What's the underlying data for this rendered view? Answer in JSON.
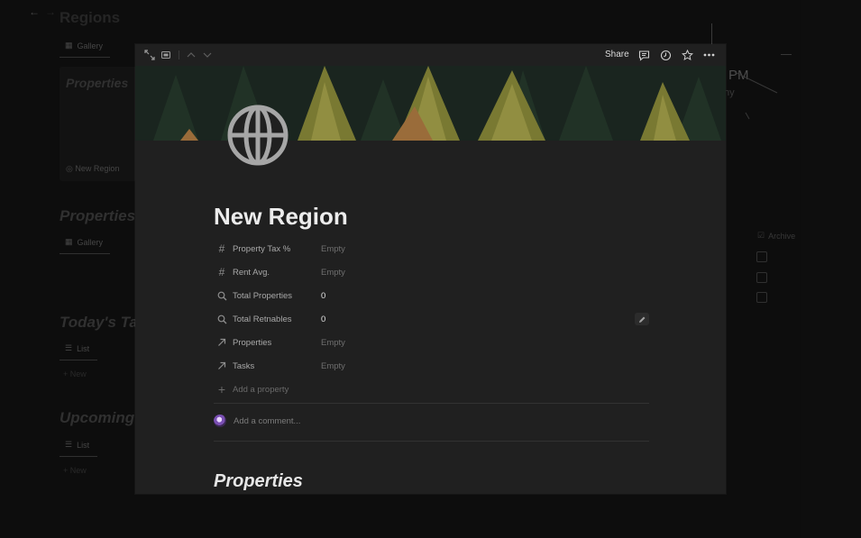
{
  "background": {
    "nav_back": "←",
    "nav_fwd": "→",
    "page_title": "Regions",
    "section1_tab": "Gallery",
    "card_title": "Properties",
    "card_item": "New Region",
    "section2_title": "Properties",
    "section2_tab": "Gallery",
    "section3_title": "Today's Ta",
    "section3_tab": "List",
    "section3_new": "+ New",
    "section4_title": "Upcoming",
    "section4_tab": "List",
    "section4_new": "+ New",
    "clock_text": "PM",
    "clock_sub": "ny",
    "archive_label": "Archive"
  },
  "toolbar": {
    "share_label": "Share"
  },
  "page": {
    "title": "New Region",
    "properties": [
      {
        "icon": "number-icon",
        "name": "Property Tax %",
        "value": "Empty",
        "empty": true
      },
      {
        "icon": "number-icon",
        "name": "Rent Avg.",
        "value": "Empty",
        "empty": true
      },
      {
        "icon": "rollup-search-icon",
        "name": "Total Properties",
        "value": "0",
        "empty": false
      },
      {
        "icon": "rollup-search-icon",
        "name": "Total Retnables",
        "value": "0",
        "empty": false
      },
      {
        "icon": "relation-arrow-icon",
        "name": "Properties",
        "value": "Empty",
        "empty": true
      },
      {
        "icon": "relation-arrow-icon",
        "name": "Tasks",
        "value": "Empty",
        "empty": true
      }
    ],
    "add_property_label": "Add a property",
    "comment_placeholder": "Add a comment...",
    "section_heading": "Properties"
  }
}
